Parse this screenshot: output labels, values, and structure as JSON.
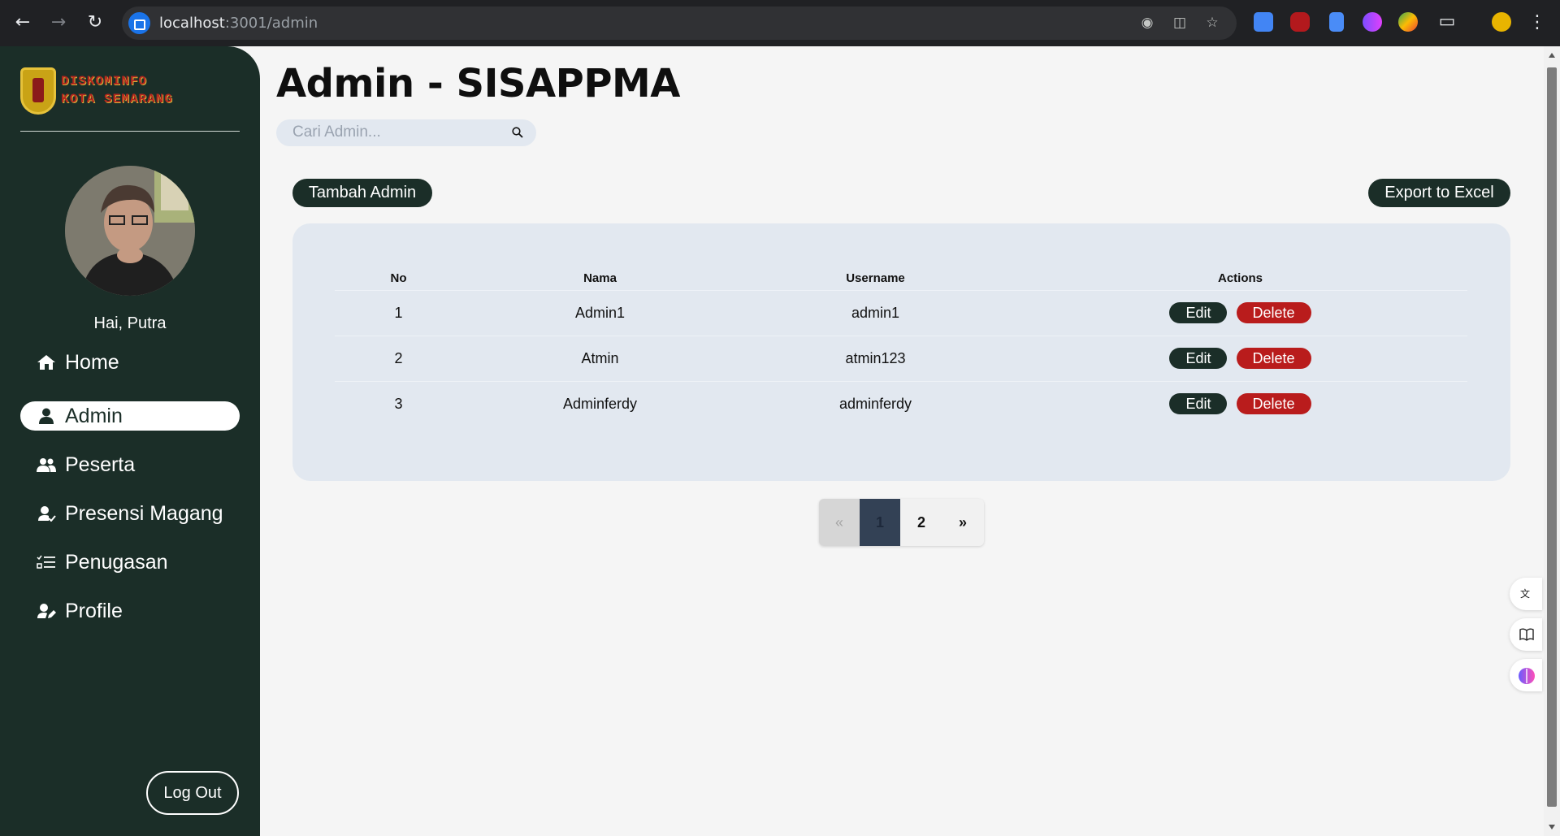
{
  "browser": {
    "url_host": "localhost",
    "url_path": ":3001/admin"
  },
  "sidebar": {
    "logo_line1": "DISKOMINFO",
    "logo_line2": "KOTA SEMARANG",
    "greeting": "Hai, Putra",
    "items": [
      {
        "label": "Home",
        "icon": "home-icon"
      },
      {
        "label": "Admin",
        "icon": "user-icon",
        "active": true
      },
      {
        "label": "Peserta",
        "icon": "users-icon"
      },
      {
        "label": "Presensi Magang",
        "icon": "user-check-icon"
      },
      {
        "label": "Penugasan",
        "icon": "task-list-icon"
      },
      {
        "label": "Profile",
        "icon": "user-edit-icon"
      }
    ],
    "logout_label": "Log Out"
  },
  "main": {
    "title": "Admin - SISAPPMA",
    "search_placeholder": "Cari Admin...",
    "add_button": "Tambah Admin",
    "export_button": "Export to Excel",
    "table": {
      "headers": [
        "No",
        "Nama",
        "Username",
        "Actions"
      ],
      "rows": [
        {
          "no": "1",
          "nama": "Admin1",
          "username": "admin1"
        },
        {
          "no": "2",
          "nama": "Atmin",
          "username": "atmin123"
        },
        {
          "no": "3",
          "nama": "Adminferdy",
          "username": "adminferdy"
        }
      ],
      "edit_label": "Edit",
      "delete_label": "Delete"
    },
    "pagination": {
      "prev": "«",
      "pages": [
        "1",
        "2"
      ],
      "next": "»",
      "current": "1"
    }
  },
  "colors": {
    "sidebar_bg": "#1b2e28",
    "primary": "#1b2e28",
    "danger": "#b91c1c",
    "table_bg": "#e2e8f0"
  }
}
